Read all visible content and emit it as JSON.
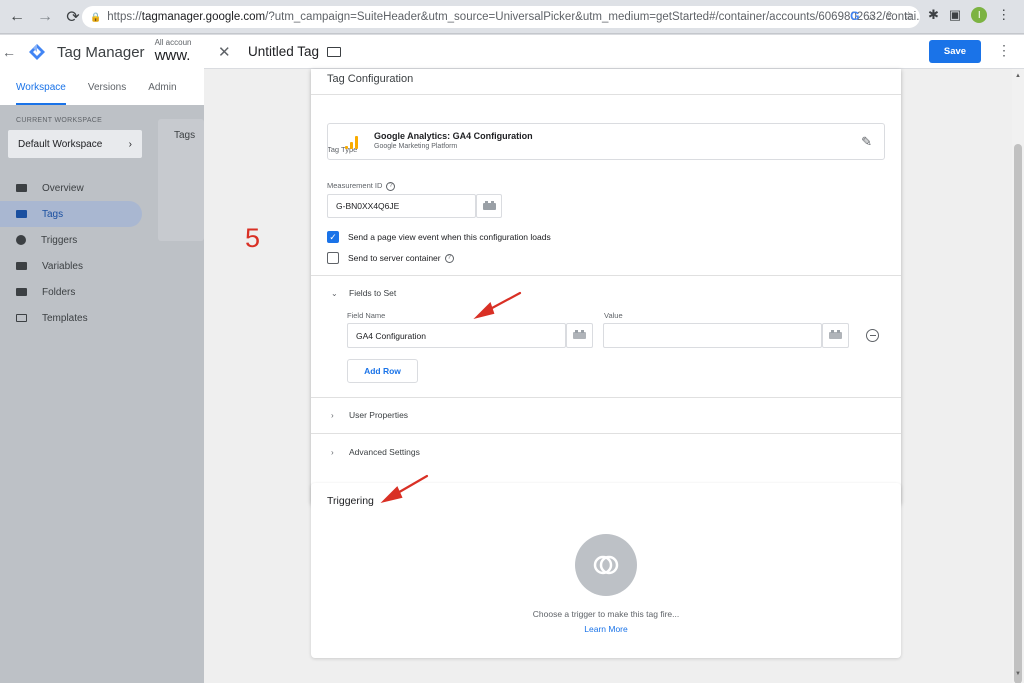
{
  "browser": {
    "url_prefix": "https://",
    "url_host": "tagmanager.google.com",
    "url_rest": "/?utm_campaign=SuiteHeader&utm_source=UniversalPicker&utm_medium=getStarted#/container/accounts/6069802632/contai...",
    "profile_initial": "I"
  },
  "gtm": {
    "app_title": "Tag Manager",
    "account_label": "All accoun",
    "container_label": "www.",
    "tabs": [
      {
        "label": "Workspace"
      },
      {
        "label": "Versions"
      },
      {
        "label": "Admin"
      }
    ],
    "current_workspace_caption": "CURRENT WORKSPACE",
    "workspace_name": "Default Workspace",
    "nav": [
      {
        "label": "Overview"
      },
      {
        "label": "Tags"
      },
      {
        "label": "Triggers"
      },
      {
        "label": "Variables"
      },
      {
        "label": "Folders"
      },
      {
        "label": "Templates"
      }
    ],
    "tags_card_title": "Tags"
  },
  "editor": {
    "title": "Untitled Tag",
    "save_label": "Save",
    "config": {
      "title": "Tag Configuration",
      "tag_type_caption": "Tag Type",
      "tag_type_name": "Google Analytics: GA4 Configuration",
      "tag_type_provider": "Google Marketing Platform",
      "measurement_id_caption": "Measurement ID",
      "measurement_id_value": "G-BN0XX4Q6JE",
      "checkbox_pageview_label": "Send a page view event when this configuration loads",
      "checkbox_pageview_checked": true,
      "checkbox_server_label": "Send to server container",
      "checkbox_server_checked": false,
      "fields_to_set_label": "Fields to Set",
      "field_name_caption": "Field Name",
      "value_caption": "Value",
      "field_name_value": "GA4 Configuration",
      "value_value": "",
      "add_row_label": "Add Row",
      "user_properties_label": "User Properties",
      "advanced_settings_label": "Advanced Settings"
    },
    "triggering": {
      "title": "Triggering",
      "empty_text": "Choose a trigger to make this tag fire...",
      "learn_more": "Learn More"
    }
  },
  "annotation": {
    "step_number": "5",
    "color": "#d93025"
  }
}
